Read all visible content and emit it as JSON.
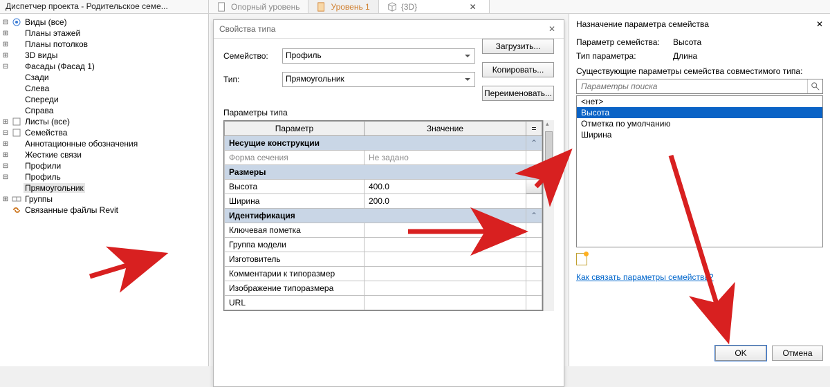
{
  "topbar": {
    "title": "Диспетчер проекта - Родительское семе...",
    "tabs": [
      {
        "icon": "doc",
        "label": "Опорный уровень"
      },
      {
        "icon": "doc-orange",
        "label": "Уровень 1"
      },
      {
        "icon": "cube",
        "label": "{3D}",
        "closable": true
      }
    ]
  },
  "tree": {
    "items": [
      {
        "ind": 0,
        "toggle": "−",
        "icon": "views",
        "label": "Виды (все)"
      },
      {
        "ind": 1,
        "toggle": "+",
        "icon": "plan",
        "label": "Планы этажей"
      },
      {
        "ind": 1,
        "toggle": "+",
        "icon": "plan",
        "label": "Планы потолков"
      },
      {
        "ind": 1,
        "toggle": "+",
        "icon": "3d",
        "label": "3D виды"
      },
      {
        "ind": 1,
        "toggle": "−",
        "icon": "section",
        "label": "Фасады (Фасад 1)"
      },
      {
        "ind": 2,
        "toggle": "",
        "icon": "",
        "label": "Сзади"
      },
      {
        "ind": 2,
        "toggle": "",
        "icon": "",
        "label": "Слева"
      },
      {
        "ind": 2,
        "toggle": "",
        "icon": "",
        "label": "Спереди"
      },
      {
        "ind": 2,
        "toggle": "",
        "icon": "",
        "label": "Справа"
      },
      {
        "ind": 0,
        "toggle": "+",
        "icon": "sheets",
        "label": "Листы (все)"
      },
      {
        "ind": 0,
        "toggle": "−",
        "icon": "family",
        "label": "Семейства"
      },
      {
        "ind": 1,
        "toggle": "+",
        "icon": "",
        "label": "Аннотационные обозначения"
      },
      {
        "ind": 1,
        "toggle": "+",
        "icon": "",
        "label": "Жесткие связи"
      },
      {
        "ind": 1,
        "toggle": "−",
        "icon": "",
        "label": "Профили"
      },
      {
        "ind": 2,
        "toggle": "−",
        "icon": "",
        "label": "Профиль"
      },
      {
        "ind": 3,
        "toggle": "",
        "icon": "",
        "label": "Прямоугольник",
        "sel": true
      },
      {
        "ind": 0,
        "toggle": "+",
        "icon": "groups",
        "label": "Группы"
      },
      {
        "ind": 0,
        "toggle": "",
        "icon": "link",
        "label": "Связанные файлы Revit"
      }
    ]
  },
  "typeDlg": {
    "title": "Свойства типа",
    "family_lbl": "Семейство:",
    "family_val": "Профиль",
    "type_lbl": "Тип:",
    "type_val": "Прямоугольник",
    "btn_load": "Загрузить...",
    "btn_copy": "Копировать...",
    "btn_rename": "Переименовать...",
    "section": "Параметры типа",
    "th_param": "Параметр",
    "th_value": "Значение",
    "th_eq": "=",
    "rows": [
      {
        "group": true,
        "label": "Несущие конструкции"
      },
      {
        "dim": true,
        "p": "Форма сечения",
        "v": "Не задано"
      },
      {
        "group": true,
        "label": "Размеры"
      },
      {
        "p": "Высота",
        "v": "400.0",
        "btn": true
      },
      {
        "p": "Ширина",
        "v": "200.0"
      },
      {
        "group": true,
        "label": "Идентификация"
      },
      {
        "p": "Ключевая пометка",
        "v": ""
      },
      {
        "p": "Группа модели",
        "v": ""
      },
      {
        "p": "Изготовитель",
        "v": ""
      },
      {
        "p": "Комментарии к типоразмер",
        "v": ""
      },
      {
        "p": "Изображение типоразмера",
        "v": ""
      },
      {
        "p": "URL",
        "v": ""
      }
    ]
  },
  "assignDlg": {
    "title": "Назначение параметра семейства",
    "param_lbl": "Параметр семейства:",
    "param_val": "Высота",
    "ptype_lbl": "Тип параметра:",
    "ptype_val": "Длина",
    "exist_lbl": "Существующие параметры семейства совместимого типа:",
    "search_ph": "Параметры поиска",
    "items": [
      "<нет>",
      "Высота",
      "Отметка по умолчанию",
      "Ширина"
    ],
    "selected_index": 1,
    "link": "Как связать параметры семейства?",
    "ok": "OK",
    "cancel": "Отмена"
  }
}
